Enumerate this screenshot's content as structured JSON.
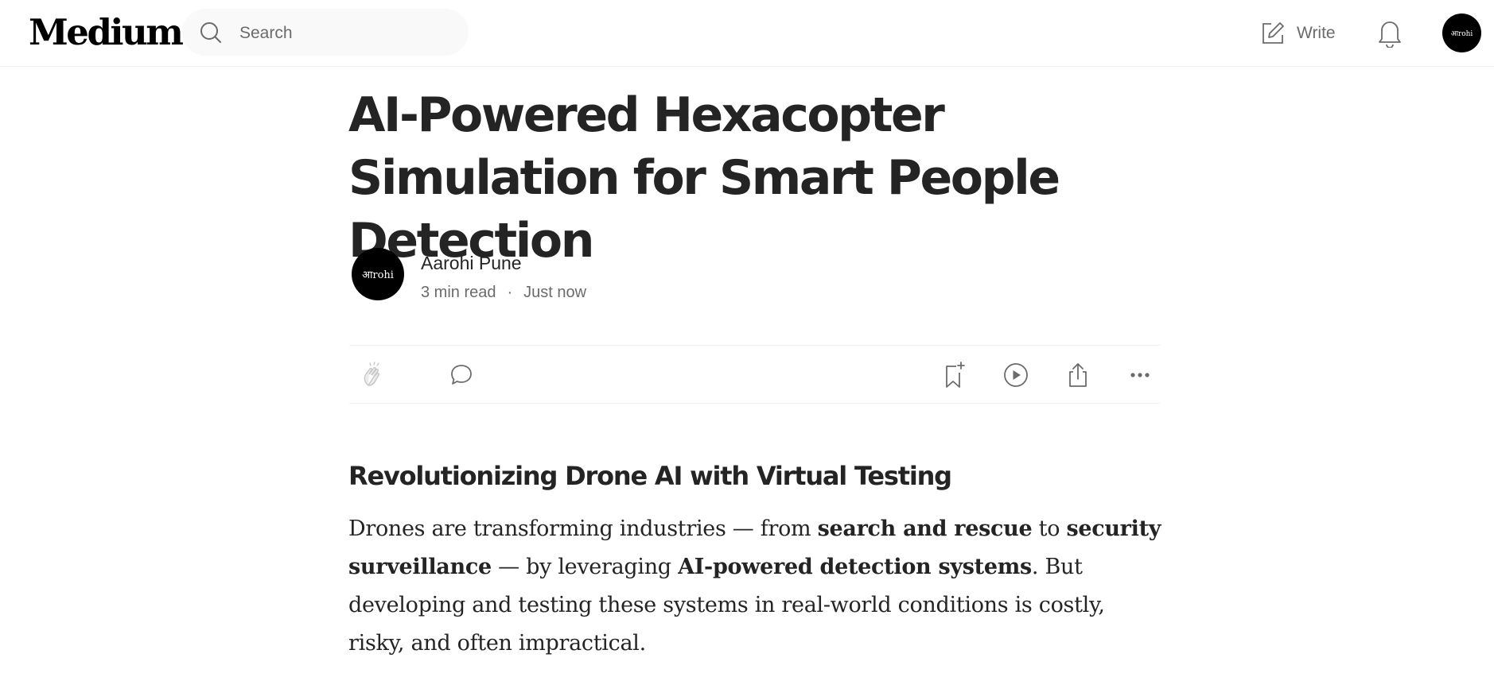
{
  "header": {
    "logo": "Medium",
    "search_placeholder": "Search",
    "write_label": "Write",
    "avatar_text": "आrohi"
  },
  "article": {
    "title": "AI-Powered Hexacopter Simulation for Smart People Detection",
    "author": {
      "name": "Aarohi Pune",
      "avatar_text": "आrohi"
    },
    "read_time": "3 min read",
    "separator": "·",
    "published": "Just now",
    "subheading": "Revolutionizing Drone AI with Virtual Testing",
    "paragraph": {
      "p1": "Drones are transforming industries — from ",
      "b1": "search and rescue",
      "p2": " to ",
      "b2": "security surveillance",
      "p3": " — by leveraging ",
      "b3": "AI-powered detection systems",
      "p4": ". But developing and testing these systems in real-world conditions is costly, risky, and often impractical."
    }
  },
  "actions": {
    "icons": [
      "clap-icon",
      "comment-icon",
      "bookmark-add-icon",
      "listen-play-icon",
      "share-icon",
      "more-icon"
    ]
  },
  "colors": {
    "text": "#242424",
    "muted": "#6b6b6b",
    "search_bg": "#f9f9f9",
    "divider": "#f2f2f2"
  }
}
